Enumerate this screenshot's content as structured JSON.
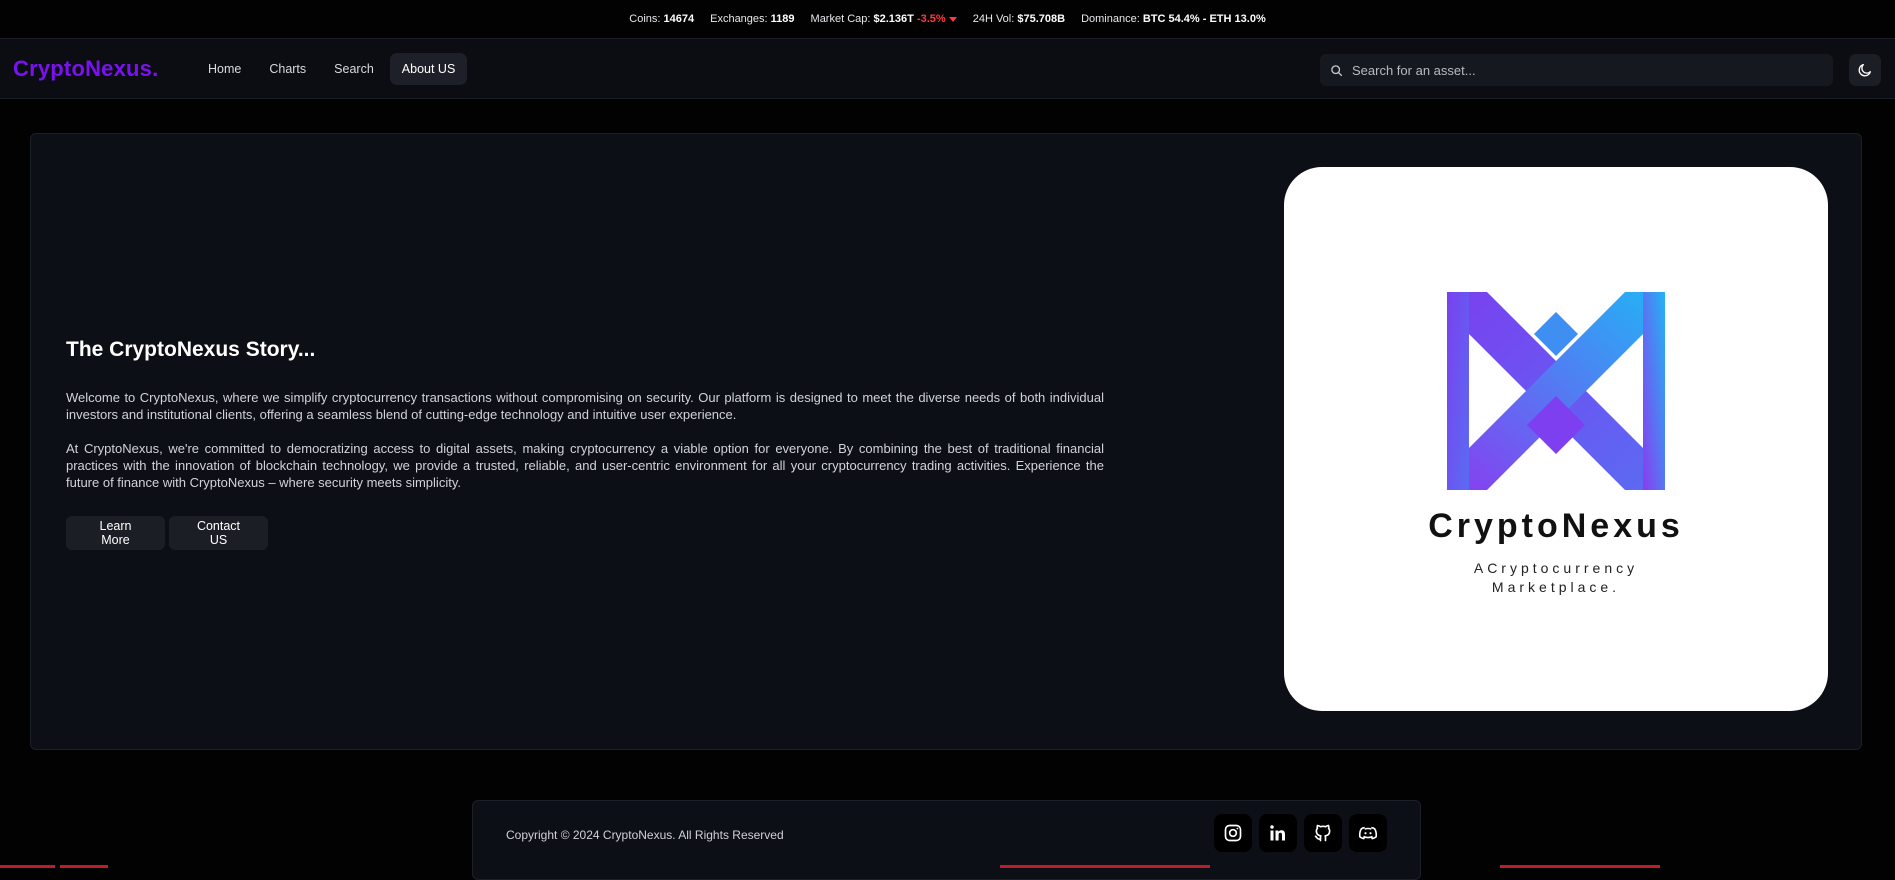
{
  "ticker": {
    "coins_label": "Coins:",
    "coins_value": "14674",
    "exchanges_label": "Exchanges:",
    "exchanges_value": "1189",
    "market_cap_label": "Market Cap:",
    "market_cap_value": "$2.136T",
    "market_cap_change": "-3.5%",
    "volume_label": "24H Vol:",
    "volume_value": "$75.708B",
    "dominance_label": "Dominance:",
    "dominance_value": "BTC 54.4% - ETH 13.0%",
    "negative_color": "#ff3b3b"
  },
  "navbar": {
    "brand": "CryptoNexus.",
    "brand_color": "#7a12f0",
    "links": [
      {
        "label": "Home",
        "active": false
      },
      {
        "label": "Charts",
        "active": false
      },
      {
        "label": "Search",
        "active": false
      },
      {
        "label": "About US",
        "active": true
      }
    ],
    "search_placeholder": "Search for an asset...",
    "search_icon": "search-icon",
    "theme_icon": "moon-icon"
  },
  "about": {
    "title": "The CryptoNexus Story...",
    "paragraph1": "Welcome to CryptoNexus, where we simplify cryptocurrency transactions without compromising on security. Our platform is designed to meet the diverse needs of both individual investors and institutional clients, offering a seamless blend of cutting-edge technology and intuitive user experience.",
    "paragraph2": "At CryptoNexus, we're committed to democratizing access to digital assets, making cryptocurrency a viable option for everyone. By combining the best of traditional financial practices with the innovation of blockchain technology, we provide a trusted, reliable, and user-centric environment for all your cryptocurrency trading activities. Experience the future of finance with CryptoNexus – where security meets simplicity.",
    "learn_more_label": "Learn More",
    "contact_label": "Contact US",
    "logo_name": "CryptoNexus",
    "logo_tagline": "ACryptocurrency Marketplace."
  },
  "footer": {
    "copyright": "Copyright © 2024 CryptoNexus. All Rights Reserved",
    "social_icons": [
      "instagram-icon",
      "linkedin-icon",
      "github-icon",
      "discord-icon"
    ]
  }
}
